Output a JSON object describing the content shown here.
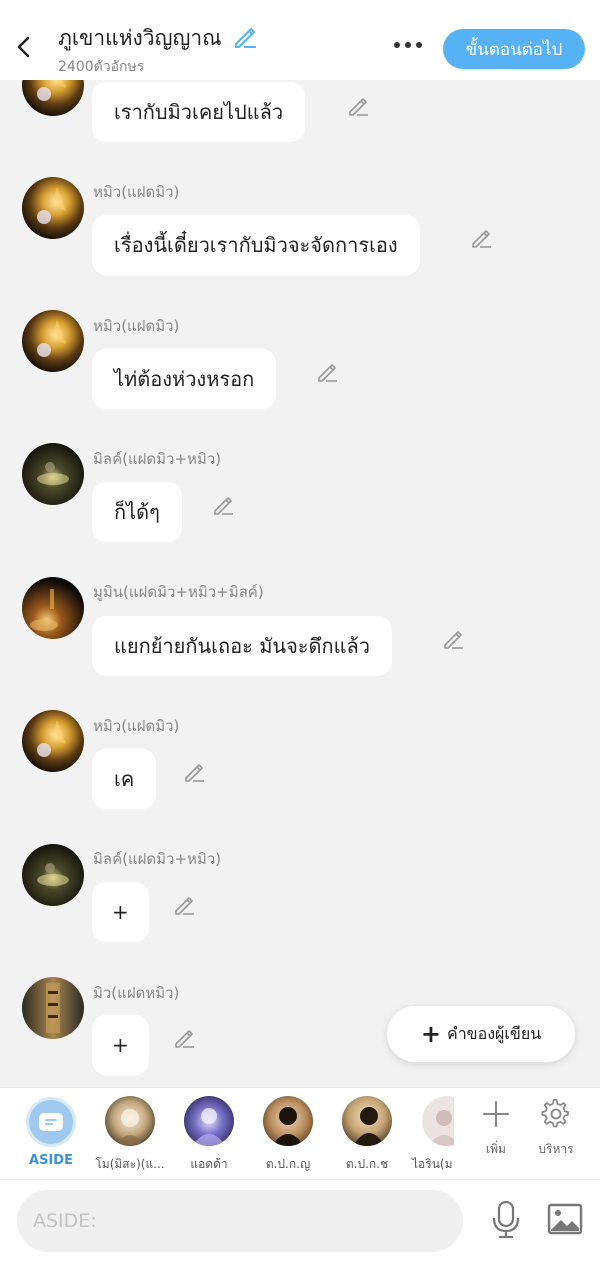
{
  "header": {
    "title": "ภูเขาแห่งวิญญาณ",
    "char_count": "2400ตัวอักษร",
    "next_label": "ขั้นตอนต่อไป"
  },
  "messages": [
    {
      "name": "",
      "text": "เรากับมิวเคยไปแล้ว",
      "avatar": "fairy-glow"
    },
    {
      "name": "หมิว(แฝดมิว)",
      "text": "เรื่องนี้เดี๋ยวเรากับมิวจะจัดการเอง",
      "avatar": "fairy-glow"
    },
    {
      "name": "หมิว(แฝดมิว)",
      "text": "ไท่ต้องห่วงหรอก",
      "avatar": "fairy-glow"
    },
    {
      "name": "มิลค์(แฝดมิว+หมิว)",
      "text": "ก็ได้ๆ",
      "avatar": "dark-fairy"
    },
    {
      "name": "มูมิน(แฝดมิว+หมิว+มิลค์)",
      "text": "แยกย้ายกันเถอะ มันจะดึกแล้ว",
      "avatar": "dark-warm"
    },
    {
      "name": "หมิว(แฝดมิว)",
      "text": "เค",
      "avatar": "fairy-glow"
    },
    {
      "name": "มิลค์(แฝดมิว+หมิว)",
      "text": "+",
      "avatar": "dark-fairy"
    },
    {
      "name": "มิว(แฝดหมิว)",
      "text": "+",
      "avatar": "bookshelf"
    }
  ],
  "author_note": {
    "label": "คำของผู้เขียน"
  },
  "characters": {
    "aside_label": "ASIDE",
    "items": [
      {
        "label": "โม(มิสะ)(แ..."
      },
      {
        "label": "แอดด้า"
      },
      {
        "label": "ต.ป.ก.ญ"
      },
      {
        "label": "ต.ป.ก.ช"
      },
      {
        "label": "ไอริน(ม"
      }
    ],
    "add_label": "เพิ่ม",
    "manage_label": "บริหาร"
  },
  "input": {
    "placeholder": "ASIDE:"
  },
  "colors": {
    "accent": "#56b2f5",
    "aside": "#3a8fe0",
    "background": "#f2f2f2"
  },
  "icons": [
    "chevron-left-icon",
    "pencil-icon",
    "more-dots-icon",
    "plus-icon",
    "gear-icon",
    "microphone-icon",
    "image-icon"
  ]
}
